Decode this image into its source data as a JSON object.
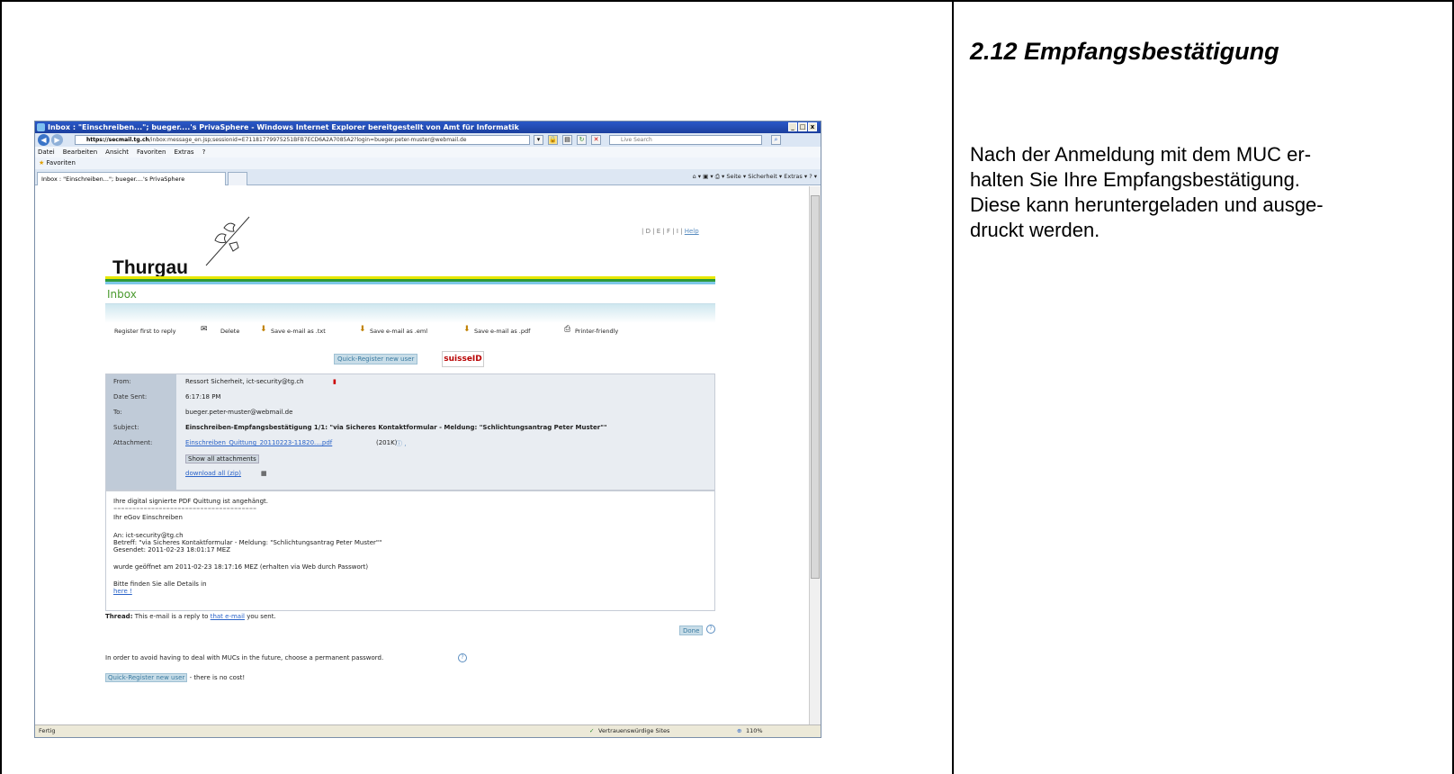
{
  "section": {
    "title": "2.12  Empfangsbestätigung",
    "paragraph_lines": [
      "Nach der Anmeldung mit dem MUC er-",
      "halten Sie Ihre Empfangsbestätigung.",
      "Diese kann heruntergeladen und ausge-",
      "druckt werden."
    ]
  },
  "browser": {
    "window_title": "Inbox : \"Einschreiben...\"; bueger....'s PrivaSphere - Windows Internet Explorer bereitgestellt von Amt für Informatik",
    "url_domain": "https://secmail.tg.ch",
    "url_rest": "/inbox:message_en.jsp;sessionid=E71181779975251BFB7ECD6A2A7085A2?login=bueger.peter-muster@webmail.de",
    "search_placeholder": "Live Search",
    "menu": [
      "Datei",
      "Bearbeiten",
      "Ansicht",
      "Favoriten",
      "Extras",
      "?"
    ],
    "favorites_label": "Favoriten",
    "tab_label": "Inbox : \"Einschreiben...\"; bueger....'s PrivaSphere",
    "cmd_items": "Seite ▾  Sicherheit ▾  Extras ▾",
    "status_left": "Fertig",
    "status_zone": "Vertrauenswürdige Sites",
    "zoom": "110%"
  },
  "page": {
    "lang_links": "| D | E | F | I |",
    "help_link": "Help",
    "logo_text": "Thurgau",
    "inbox_title": "Inbox",
    "toolbar": {
      "register": "Register first to reply",
      "delete": "Delete",
      "save_txt": "Save e-mail as .txt",
      "save_eml": "Save e-mail as .eml",
      "save_pdf": "Save e-mail as .pdf",
      "printer": "Printer-friendly"
    },
    "quick_register": "Quick-Register new user",
    "suisse_id": "suisseID",
    "headers": {
      "from_label": "From:",
      "from": "Ressort Sicherheit, ict-security@tg.ch",
      "date_label": "Date Sent:",
      "date": "6:17:18 PM",
      "to_label": "To:",
      "to": "bueger.peter-muster@webmail.de",
      "subject_label": "Subject:",
      "subject": "Einschreiben-Empfangsbestätigung 1/1: \"via Sicheres Kontaktformular - Meldung: \"Schlichtungsantrag Peter Muster\"\"",
      "attachment_label": "Attachment:",
      "attachment": "Einschreiben_Quittung_20110223-11820....pdf",
      "attachment_size": "(201K)",
      "show_all": "Show all attachments",
      "download_all": "download all (zip)"
    },
    "body": {
      "line1": "Ihre digital signierte PDF Quittung ist angehängt.",
      "separator": "======================================",
      "line2": "Ihr eGov Einschreiben",
      "an": "An: ict-security@tg.ch",
      "betreff": "Betreff: \"via Sicheres Kontaktformular - Meldung: \"Schlichtungsantrag Peter Muster\"\"",
      "gesendet": "Gesendet: 2011-02-23 18:01:17 MEZ",
      "geoeffnet": "wurde geöffnet am 2011-02-23 18:17:16 MEZ (erhalten via Web durch Passwort)",
      "finden": "Bitte finden Sie alle Details in",
      "here": "here !"
    },
    "thread_label": "Thread:",
    "thread_text": "This e-mail is a reply to",
    "thread_link": "that e-mail",
    "thread_end": "you sent.",
    "done": "Done",
    "avoid_text": "In order to avoid having to deal with MUCs in the future, choose a permanent password.",
    "no_cost": "- there is no cost!"
  }
}
